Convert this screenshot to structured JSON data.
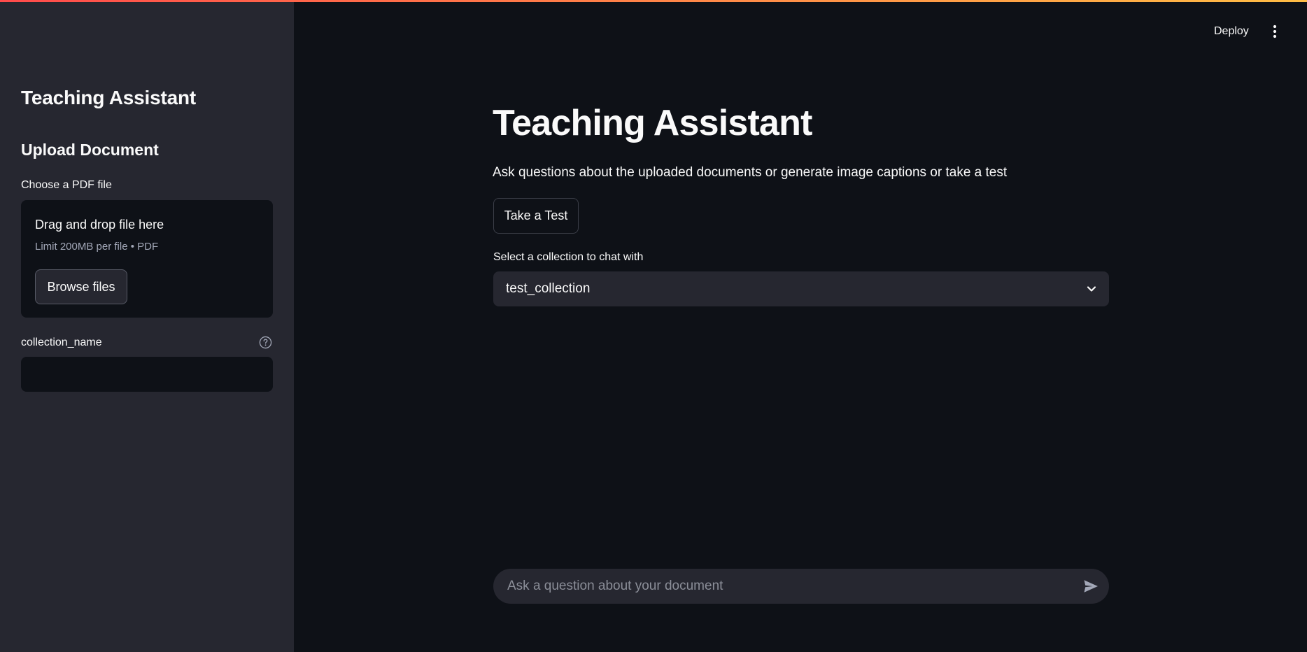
{
  "sidebar": {
    "title": "Teaching Assistant",
    "subtitle": "Upload Document",
    "file_label": "Choose a PDF file",
    "dropzone": {
      "title": "Drag and drop file here",
      "limit": "Limit 200MB per file • PDF",
      "browse_label": "Browse files"
    },
    "collection_label": "collection_name",
    "collection_value": ""
  },
  "header": {
    "deploy_label": "Deploy",
    "menu_icon": "more-vertical-icon"
  },
  "main": {
    "title": "Teaching Assistant",
    "description": "Ask questions about the uploaded documents or generate image captions or take a test",
    "test_button_label": "Take a Test",
    "select_label": "Select a collection to chat with",
    "select_value": "test_collection"
  },
  "chat": {
    "placeholder": "Ask a question about your document",
    "send_icon": "send-icon"
  },
  "colors": {
    "background": "#0e1117",
    "sidebar": "#262730",
    "accent_gradient_start": "#ff4b4b",
    "accent_gradient_end": "#ffbd45"
  }
}
